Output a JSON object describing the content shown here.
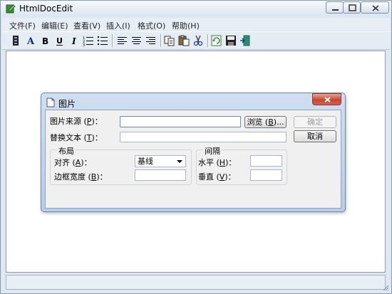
{
  "window": {
    "title": "HtmlDocEdit",
    "menu": [
      "文件(F)",
      "编辑(E)",
      "查看(V)",
      "插入(I)",
      "格式(O)",
      "帮助(H)"
    ]
  },
  "toolbar": {
    "icons": [
      "format-icon",
      "font-icon",
      "bold-icon",
      "underline-icon",
      "italic-icon",
      "numbered-list-icon",
      "bullet-list-icon",
      "align-left-icon",
      "align-center-icon",
      "align-right-icon",
      "copy-icon",
      "paste-icon",
      "cut-icon",
      "refresh-icon",
      "save-icon",
      "exit-icon"
    ],
    "glyphs": {
      "font": "A",
      "bold": "B",
      "underline": "U",
      "italic": "I"
    }
  },
  "dialog": {
    "title": "图片",
    "image_source": {
      "label_pre": "图片来源 (",
      "key": "P",
      "label_post": ")：",
      "value": ""
    },
    "alt_text": {
      "label_pre": "替换文本 (",
      "key": "T",
      "label_post": ")：",
      "value": ""
    },
    "browse_button": {
      "pre": "浏览 (",
      "key": "B",
      "post": ")..."
    },
    "ok_button": "确定",
    "cancel_button": "取消",
    "layout": {
      "legend": "布局",
      "align": {
        "label_pre": "对齐 (",
        "key": "A",
        "label_post": ")：",
        "value": "基线"
      },
      "border": {
        "label_pre": "边框宽度 (",
        "key": "B",
        "label_post": ")：",
        "value": ""
      }
    },
    "spacing": {
      "legend": "间隔",
      "horizontal": {
        "label_pre": "水平 (",
        "key": "H",
        "label_post": ")：",
        "value": ""
      },
      "vertical": {
        "label_pre": "垂直 (",
        "key": "V",
        "label_post": ")：",
        "value": ""
      }
    }
  }
}
